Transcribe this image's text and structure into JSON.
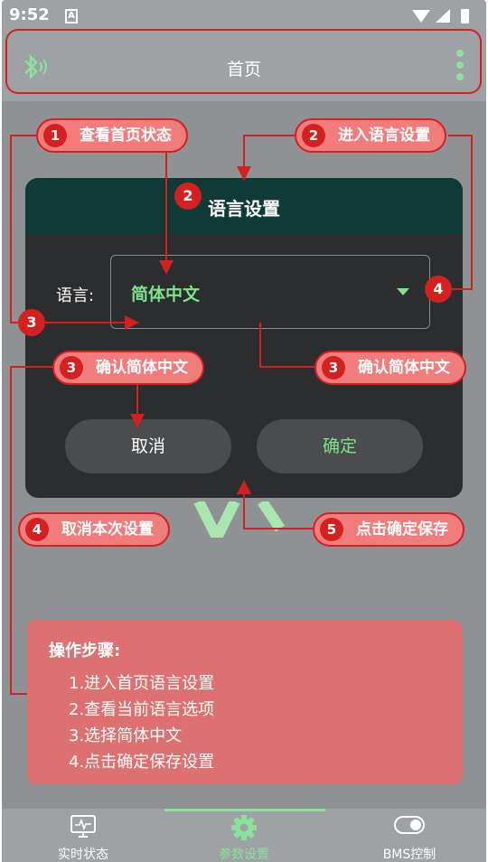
{
  "status_bar": {
    "time": "9:52",
    "notification_icon": "a-icon",
    "icons": [
      "wifi-icon",
      "signal-icon",
      "battery-icon"
    ]
  },
  "app_bar": {
    "title": "首页",
    "left_icon": "bluetooth-icon",
    "right_icon": "more-vert-icon"
  },
  "dialog": {
    "title": "语言设置",
    "language_label": "语言:",
    "language_value": "简体中文",
    "cancel_label": "取消",
    "ok_label": "确定"
  },
  "callouts": {
    "c1": {
      "num": "1",
      "text": "查看首页状态"
    },
    "c2": {
      "num": "2",
      "text": "进入语言设置"
    },
    "c3a": {
      "num": "3",
      "text": "确认简体中文"
    },
    "c3b": {
      "num": "3",
      "text": "确认简体中文"
    },
    "c4": {
      "num": "4",
      "text": "取消本次设置"
    },
    "c5": {
      "num": "5",
      "text": "点击确定保存"
    }
  },
  "badges": {
    "b2": "2",
    "b3": "3",
    "b4": "4"
  },
  "steps": {
    "title": "操作步骤:",
    "items": [
      "1.进入首页语言设置",
      "2.查看当前语言选项",
      "3.选择简体中文",
      "4.点击确定保存设置"
    ]
  },
  "bottom_nav": {
    "items": [
      {
        "label": "实时状态",
        "icon": "monitor-icon"
      },
      {
        "label": "参数设置",
        "icon": "gear-icon"
      },
      {
        "label": "BMS控制",
        "icon": "toggle-icon"
      }
    ],
    "active_index": 1
  },
  "colors": {
    "accent_green": "#7ee38a",
    "annotation_red": "#d32121",
    "callout_fill": "#f07c7c",
    "dialog_header": "#0f3a36"
  }
}
